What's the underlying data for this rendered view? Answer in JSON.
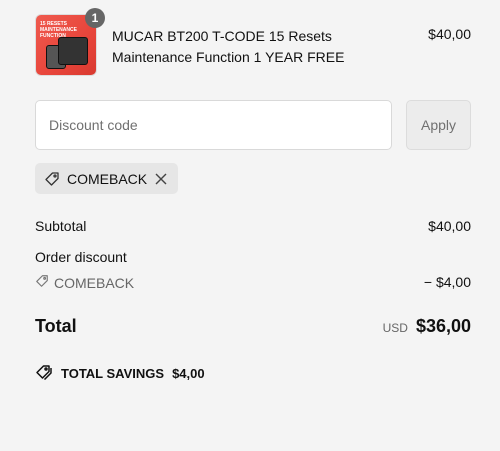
{
  "product": {
    "title": "MUCAR BT200 T-CODE 15 Resets Maintenance Function 1 YEAR FREE",
    "price": "$40,00",
    "quantity": "1",
    "thumb_text": "15 RESETS MAINTENANCE FUNCTION"
  },
  "discount": {
    "placeholder": "Discount code",
    "apply_label": "Apply",
    "applied_code": "COMEBACK"
  },
  "summary": {
    "subtotal_label": "Subtotal",
    "subtotal_value": "$40,00",
    "order_discount_label": "Order discount",
    "discount_code": "COMEBACK",
    "discount_value": "− $4,00",
    "total_label": "Total",
    "currency": "USD",
    "total_value": "$36,00",
    "savings_label": "TOTAL SAVINGS",
    "savings_value": "$4,00"
  },
  "colors": {
    "background": "#f4f4f4",
    "badge": "#666666",
    "tag_bg": "#e6e6e6",
    "muted": "#707070"
  }
}
